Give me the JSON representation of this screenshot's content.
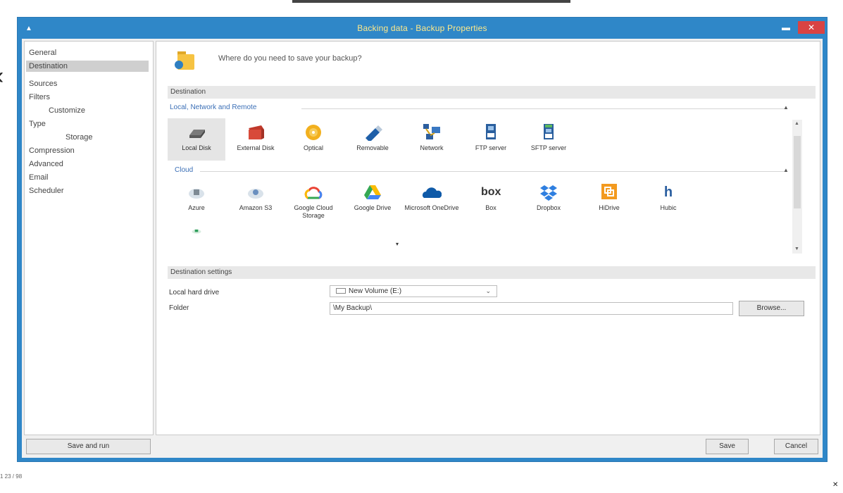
{
  "window": {
    "title_left": "Backing data",
    "title_sep": " - ",
    "title_right": "Backup Properties"
  },
  "nav": {
    "items": [
      {
        "label": "General"
      },
      {
        "label": "Destination"
      },
      {
        "label": "Sources"
      },
      {
        "label": "Filters"
      },
      {
        "label": "Customize"
      },
      {
        "label": "Type"
      },
      {
        "label": "Storage"
      },
      {
        "label": "Compression"
      },
      {
        "label": "Advanced"
      },
      {
        "label": "Email"
      },
      {
        "label": "Scheduler"
      }
    ],
    "selected": "Destination"
  },
  "header": {
    "question": "Where do you need to save your backup?"
  },
  "sections": {
    "destination": "Destination",
    "destination_settings": "Destination settings"
  },
  "groups": {
    "local": "Local, Network and Remote",
    "cloud": "Cloud"
  },
  "local_tiles": [
    {
      "label": "Local Disk",
      "icon": "local-disk-icon"
    },
    {
      "label": "External Disk",
      "icon": "external-disk-icon"
    },
    {
      "label": "Optical",
      "icon": "optical-disc-icon"
    },
    {
      "label": "Removable",
      "icon": "usb-drive-icon"
    },
    {
      "label": "Network",
      "icon": "network-icon"
    },
    {
      "label": "FTP server",
      "icon": "ftp-server-icon"
    },
    {
      "label": "SFTP server",
      "icon": "sftp-server-icon"
    }
  ],
  "cloud_tiles": [
    {
      "label": "Azure",
      "icon": "azure-icon"
    },
    {
      "label": "Amazon S3",
      "icon": "amazon-s3-icon"
    },
    {
      "label": "Google Cloud Storage",
      "icon": "google-cloud-icon"
    },
    {
      "label": "Google Drive",
      "icon": "google-drive-icon"
    },
    {
      "label": "Microsoft OneDrive",
      "icon": "onedrive-icon"
    },
    {
      "label": "Box",
      "icon": "box-icon",
      "glyph": "box"
    },
    {
      "label": "Dropbox",
      "icon": "dropbox-icon"
    },
    {
      "label": "HiDrive",
      "icon": "hidrive-icon"
    },
    {
      "label": "Hubic",
      "icon": "hubic-icon",
      "glyph": "h"
    }
  ],
  "settings": {
    "drive_label": "Local hard drive",
    "drive_value": "New Volume (E:)",
    "folder_label": "Folder",
    "folder_value": "\\My Backup\\",
    "browse_label": "Browse..."
  },
  "footer": {
    "save_and_run": "Save and run",
    "save": "Save",
    "cancel": "Cancel"
  },
  "status": {
    "text": "1 23 / 98",
    "close_glyph": "✕"
  },
  "colors": {
    "titlebar": "#2f87c8",
    "title_text": "#ffe98a",
    "close_button": "#d94343",
    "group_label": "#3b6fb6"
  }
}
